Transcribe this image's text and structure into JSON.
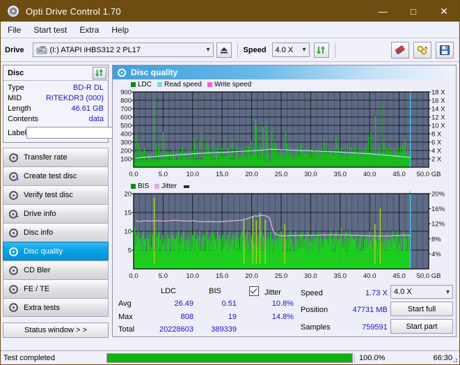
{
  "window": {
    "title": "Opti Drive Control 1.70",
    "app_icon": "disc-icon",
    "minimize": "—",
    "maximize": "□",
    "close": "✕",
    "titlebar_color": "#6f4d12"
  },
  "menu": {
    "items": [
      "File",
      "Start test",
      "Extra",
      "Help"
    ]
  },
  "toolbar": {
    "drive_label": "Drive",
    "drive_value": "(I:)  ATAPI iHBS312  2 PL17",
    "eject_icon": "eject-icon",
    "speed_label": "Speed",
    "speed_value": "4.0 X",
    "refresh_icon": "refresh-icon",
    "erase_icon": "eraser-icon",
    "plug_icon": "plug-icon",
    "save_icon": "floppy-save-icon"
  },
  "disc_panel": {
    "title": "Disc",
    "sync_icon": "refresh-icon",
    "rows": [
      {
        "key": "Type",
        "value": "BD-R DL"
      },
      {
        "key": "MID",
        "value": "RITEKDR3 (000)"
      },
      {
        "key": "Length",
        "value": "46.61 GB"
      },
      {
        "key": "Contents",
        "value": "data"
      }
    ],
    "label_key": "Label",
    "label_value": "",
    "label_placeholder": "",
    "disc_icon": "cd-icon"
  },
  "nav": {
    "items": [
      {
        "label": "Transfer rate",
        "icon": "disc-icon",
        "selected": false
      },
      {
        "label": "Create test disc",
        "icon": "disc-icon",
        "selected": false
      },
      {
        "label": "Verify test disc",
        "icon": "disc-icon",
        "selected": false
      },
      {
        "label": "Drive info",
        "icon": "disc-icon",
        "selected": false
      },
      {
        "label": "Disc info",
        "icon": "disc-icon",
        "selected": false
      },
      {
        "label": "Disc quality",
        "icon": "disc-icon",
        "selected": true
      },
      {
        "label": "CD Bler",
        "icon": "disc-icon",
        "selected": false
      },
      {
        "label": "FE / TE",
        "icon": "disc-icon",
        "selected": false
      },
      {
        "label": "Extra tests",
        "icon": "disc-icon",
        "selected": false
      }
    ],
    "status_window_button": "Status window > >"
  },
  "content": {
    "title": "Disc quality",
    "icon": "disc-icon"
  },
  "chart_data": [
    {
      "type": "area",
      "id": "ldc-chart",
      "title": "",
      "xlabel": "GB",
      "ylabel": "",
      "xlim": [
        0,
        50
      ],
      "xticks": [
        0.0,
        5.0,
        10.0,
        15.0,
        20.0,
        25.0,
        30.0,
        35.0,
        40.0,
        45.0,
        50.0
      ],
      "xticklabels": [
        "0.0",
        "5.0",
        "10.0",
        "15.0",
        "20.0",
        "25.0",
        "30.0",
        "35.0",
        "40.0",
        "45.0",
        "50.0 GB"
      ],
      "ylim": [
        0,
        900
      ],
      "yticks": [
        100,
        200,
        300,
        400,
        500,
        600,
        700,
        800,
        900
      ],
      "y2lim": [
        0,
        18
      ],
      "y2ticks": [
        2,
        4,
        6,
        8,
        10,
        12,
        14,
        16,
        18
      ],
      "y2ticklabels": [
        "2 X",
        "4 X",
        "6 X",
        "8 X",
        "10 X",
        "12 X",
        "14 X",
        "16 X",
        "18 X"
      ],
      "grid": true,
      "plot_bg": "#5e6b85",
      "legend_position": "top-left",
      "legend": [
        {
          "name": "LDC",
          "color": "#0a8a18"
        },
        {
          "name": "Read speed",
          "color": "#79d4f2"
        },
        {
          "name": "Write speed",
          "color": "#f45fd0"
        }
      ],
      "series": [
        {
          "name": "LDC",
          "color": "#17c017",
          "kind": "spikes",
          "x": [
            0.2,
            0.5,
            0.9,
            1.2,
            1.5,
            1.9,
            2.3,
            2.7,
            3.0,
            3.4,
            3.8,
            4.2,
            4.3,
            4.6,
            5.0,
            5.4,
            5.6,
            5.9,
            6.3,
            6.7,
            7.1,
            7.5,
            7.9,
            8.3,
            8.7,
            9.1,
            9.5,
            9.9,
            10.3,
            10.5,
            10.8,
            11.2,
            11.5,
            11.9,
            12.2,
            12.4,
            12.8,
            13.1,
            13.5,
            13.9,
            14.3,
            14.7,
            15.1,
            15.5,
            15.9,
            16.0,
            16.3,
            16.7,
            17.1,
            17.5,
            17.9,
            18.3,
            18.7,
            19.1,
            19.5,
            19.9,
            20.3,
            20.6,
            20.8,
            21.2,
            21.6,
            22.0,
            22.4,
            22.7,
            22.9,
            23.1,
            23.4,
            23.6,
            23.9,
            24.2,
            24.6,
            25.0,
            25.4,
            25.8,
            26.0,
            26.3,
            26.7,
            27.1,
            27.5,
            27.9,
            28.3,
            28.7,
            29.1,
            29.5,
            29.9,
            30.3,
            30.7,
            31.1,
            31.5,
            31.9,
            32.3,
            32.7,
            33.1,
            33.5,
            33.9,
            34.3,
            34.7,
            35.1,
            35.5,
            35.9,
            36.3,
            36.6,
            37.0,
            37.4,
            37.8,
            38.2,
            38.6,
            39.0,
            39.4,
            39.8,
            40.2,
            40.6,
            41.0,
            41.4,
            41.8,
            42.1,
            42.4,
            42.8,
            43.2,
            43.6,
            44.0,
            44.4,
            44.8,
            45.2,
            45.6,
            46.0,
            46.4,
            46.8
          ],
          "values": [
            160,
            405,
            300,
            200,
            175,
            230,
            175,
            165,
            180,
            810,
            280,
            210,
            300,
            165,
            420,
            230,
            170,
            180,
            175,
            215,
            200,
            210,
            195,
            230,
            190,
            215,
            215,
            205,
            350,
            270,
            215,
            300,
            430,
            215,
            220,
            300,
            230,
            200,
            310,
            240,
            230,
            260,
            240,
            355,
            230,
            230,
            220,
            300,
            200,
            230,
            240,
            225,
            225,
            240,
            250,
            310,
            225,
            570,
            500,
            230,
            250,
            480,
            500,
            430,
            215,
            60,
            440,
            230,
            300,
            250,
            220,
            215,
            340,
            430,
            280,
            250,
            240,
            215,
            230,
            215,
            280,
            200,
            215,
            230,
            215,
            230,
            200,
            230,
            215,
            240,
            300,
            215,
            230,
            215,
            230,
            355,
            230,
            215,
            230,
            280,
            260,
            230,
            240,
            215,
            230,
            230,
            215,
            230,
            240,
            360,
            420,
            230,
            610,
            230,
            230,
            780,
            300,
            240,
            215,
            230,
            230,
            215,
            240,
            230,
            260,
            330,
            215,
            200
          ]
        },
        {
          "name": "Read speed",
          "color": "#9fdff6",
          "kind": "line",
          "x": [
            0.3,
            2,
            4,
            6,
            8,
            10,
            12,
            14,
            16,
            18,
            20,
            22,
            23,
            23.4,
            24,
            26,
            28,
            30,
            32,
            34,
            36,
            38,
            40,
            42,
            44,
            46,
            46.9
          ],
          "values": [
            105,
            120,
            130,
            140,
            150,
            160,
            168,
            175,
            180,
            190,
            196,
            205,
            212,
            213,
            212,
            205,
            200,
            196,
            190,
            184,
            176,
            168,
            160,
            148,
            136,
            122,
            118
          ]
        }
      ],
      "marker_line": {
        "x": 46.9,
        "color": "#4fc8f0",
        "label": ""
      }
    },
    {
      "type": "area",
      "id": "bis-chart",
      "title": "",
      "xlabel": "GB",
      "ylabel": "",
      "xlim": [
        0,
        50
      ],
      "xticks": [
        0.0,
        5.0,
        10.0,
        15.0,
        20.0,
        25.0,
        30.0,
        35.0,
        40.0,
        45.0,
        50.0
      ],
      "xticklabels": [
        "0.0",
        "5.0",
        "10.0",
        "15.0",
        "20.0",
        "25.0",
        "30.0",
        "35.0",
        "40.0",
        "45.0",
        "50.0 GB"
      ],
      "ylim": [
        0,
        20
      ],
      "yticks": [
        5,
        10,
        15,
        20
      ],
      "y2lim": [
        0,
        20
      ],
      "y2ticks": [
        4,
        8,
        12,
        16,
        20
      ],
      "y2ticklabels": [
        "4%",
        "8%",
        "12%",
        "16%",
        "20%"
      ],
      "grid": true,
      "plot_bg": "#5e6b85",
      "legend_position": "top-left",
      "legend": [
        {
          "name": "BIS",
          "color": "#0a8a18"
        },
        {
          "name": "Jitter",
          "color": "#dfaee0"
        }
      ],
      "series": [
        {
          "name": "BIS",
          "color": "#1ad41a",
          "kind": "spikes",
          "x": [
            0.2,
            0.5,
            0.8,
            1.1,
            1.4,
            1.7,
            2.0,
            2.3,
            2.6,
            2.9,
            3.2,
            3.5,
            3.8,
            4.1,
            4.3,
            4.6,
            4.9,
            5.2,
            5.5,
            5.8,
            6.1,
            6.4,
            6.7,
            7.0,
            7.3,
            7.6,
            7.9,
            8.2,
            8.5,
            8.8,
            9.1,
            9.4,
            9.7,
            10.0,
            10.3,
            10.6,
            10.9,
            11.2,
            11.5,
            11.8,
            12.1,
            12.4,
            12.7,
            13.0,
            13.3,
            13.6,
            13.9,
            14.2,
            14.5,
            14.8,
            15.1,
            15.4,
            15.7,
            16.0,
            16.3,
            16.6,
            16.9,
            17.2,
            17.5,
            17.8,
            18.1,
            18.4,
            18.7,
            19.0,
            19.3,
            19.6,
            19.9,
            20.2,
            20.5,
            20.8,
            21.1,
            21.4,
            21.7,
            22.0,
            22.3,
            22.6,
            22.9,
            23.2,
            23.5,
            23.8,
            24.1,
            24.4,
            24.7,
            25.0,
            25.3,
            25.6,
            25.9,
            26.2,
            26.5,
            26.8,
            27.1,
            27.4,
            27.7,
            28.0,
            28.3,
            28.6,
            28.9,
            29.2,
            29.5,
            29.8,
            30.1,
            30.4,
            30.7,
            31.0,
            31.3,
            31.6,
            31.9,
            32.2,
            32.5,
            32.8,
            33.1,
            33.4,
            33.7,
            34.0,
            34.3,
            34.6,
            34.9,
            35.2,
            35.5,
            35.8,
            36.1,
            36.4,
            36.7,
            37.0,
            37.3,
            37.6,
            37.9,
            38.2,
            38.5,
            38.8,
            39.1,
            39.4,
            39.7,
            40.0,
            40.3,
            40.6,
            40.9,
            41.2,
            41.5,
            41.8,
            42.1,
            42.4,
            42.7,
            43.0,
            43.3,
            43.6,
            43.9,
            44.2,
            44.5,
            44.8,
            45.1,
            45.4,
            45.7,
            46.0,
            46.3,
            46.6,
            46.9
          ],
          "values": [
            11,
            9,
            10,
            8,
            9,
            10,
            8,
            9,
            8,
            10,
            9,
            19,
            11,
            9,
            10,
            8,
            9,
            8,
            10,
            9,
            8,
            10,
            9,
            8,
            9,
            10,
            8,
            9,
            10,
            8,
            9,
            8,
            10,
            9,
            10,
            8,
            9,
            10,
            8,
            9,
            9,
            10,
            8,
            9,
            10,
            9,
            8,
            10,
            9,
            8,
            9,
            10,
            8,
            9,
            10,
            8,
            9,
            9,
            10,
            8,
            9,
            10,
            13,
            9,
            10,
            8,
            9,
            14,
            10,
            13,
            9,
            15,
            10,
            9,
            13,
            8,
            9,
            10,
            8,
            9,
            10,
            8,
            9,
            10,
            9,
            12,
            8,
            9,
            10,
            8,
            9,
            10,
            8,
            9,
            9,
            10,
            8,
            9,
            10,
            8,
            9,
            10,
            8,
            9,
            10,
            9,
            8,
            10,
            9,
            8,
            9,
            10,
            8,
            9,
            10,
            8,
            9,
            11,
            8,
            9,
            10,
            8,
            10,
            9,
            8,
            9,
            10,
            8,
            9,
            10,
            8,
            9,
            9,
            10,
            8,
            9,
            12,
            8,
            9,
            16,
            10,
            8,
            9,
            10,
            8,
            9,
            10,
            8,
            9,
            10,
            9,
            8,
            10,
            9,
            8,
            9
          ]
        },
        {
          "name": "Jitter",
          "color": "#dfaee0",
          "kind": "line",
          "x": [
            0.3,
            1,
            2,
            3,
            4,
            5,
            6,
            7,
            8,
            9,
            10,
            11,
            12,
            13,
            14,
            15,
            16,
            17,
            18,
            19,
            20,
            20.6,
            21,
            21.5,
            22,
            22.6,
            23,
            23.3,
            23.6,
            24,
            25,
            26,
            28,
            30,
            32,
            34,
            36,
            38,
            40,
            42,
            44,
            46,
            46.9
          ],
          "values": [
            12.8,
            12.6,
            12.8,
            12.7,
            12.8,
            12.7,
            12.8,
            12.9,
            12.8,
            12.7,
            12.8,
            12.6,
            12.5,
            12.6,
            12.5,
            12.6,
            12.7,
            12.8,
            12.9,
            13.2,
            13.8,
            14.1,
            14.0,
            14.3,
            14.2,
            14.0,
            13.6,
            12.0,
            10.3,
            9.2,
            8.8,
            8.8,
            8.9,
            8.9,
            9.0,
            9.0,
            9.0,
            8.9,
            8.8,
            8.7,
            8.8,
            9.0,
            8.9
          ]
        }
      ],
      "marker_line": {
        "x": 46.9,
        "color": "#4fc8f0",
        "label": ""
      }
    }
  ],
  "stats": {
    "col_headers": [
      "LDC",
      "BIS",
      "Jitter"
    ],
    "jitter_checked": true,
    "rows": [
      {
        "label": "Avg",
        "ldc": "26.49",
        "bis": "0.51",
        "jitter": "10.8%"
      },
      {
        "label": "Max",
        "ldc": "808",
        "bis": "19",
        "jitter": "14.8%"
      },
      {
        "label": "Total",
        "ldc": "20228603",
        "bis": "389339",
        "jitter": ""
      }
    ],
    "right": [
      {
        "key": "Speed",
        "value": "1.73 X"
      },
      {
        "key": "Position",
        "value": "47731 MB"
      },
      {
        "key": "Samples",
        "value": "759591"
      }
    ],
    "speed_select": "4.0 X",
    "start_full": "Start full",
    "start_part": "Start part"
  },
  "statusbar": {
    "text": "Test completed",
    "progress_percent": 100,
    "progress_label": "100.0%",
    "elapsed": "66:30",
    "progress_color": "#12b112"
  }
}
